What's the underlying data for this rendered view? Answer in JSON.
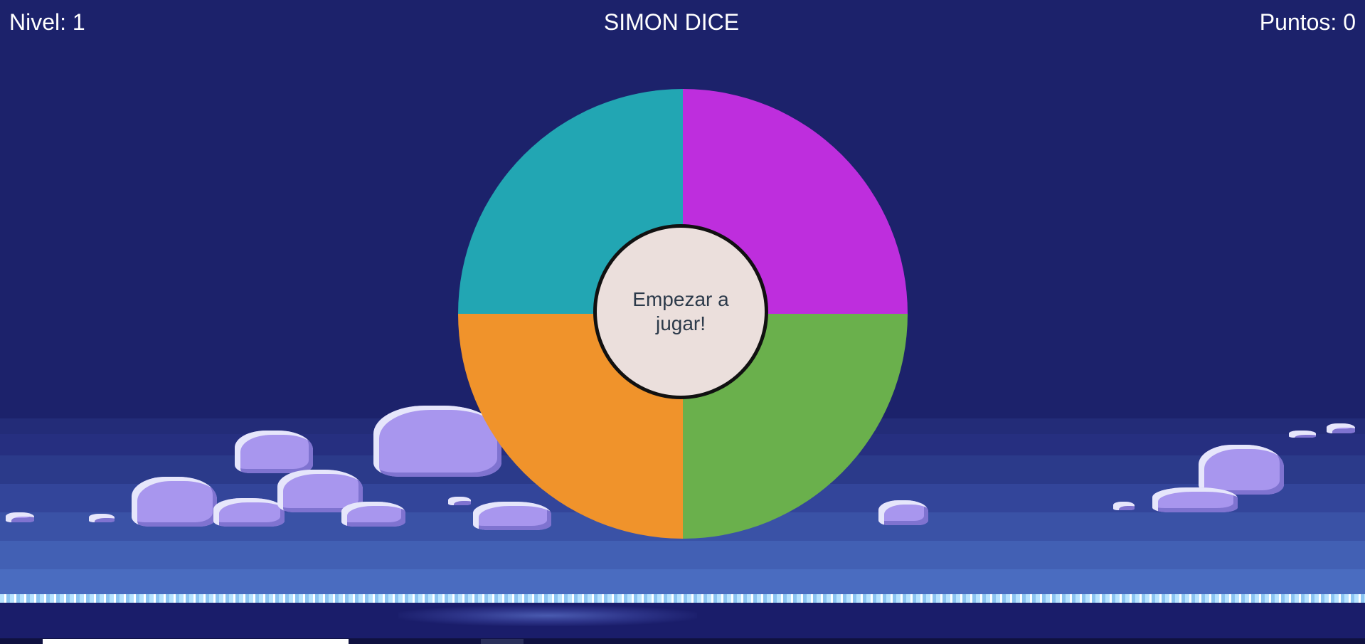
{
  "header": {
    "level_text": "Nivel: 1",
    "title": "SIMON DICE",
    "score_text": "Puntos: 0"
  },
  "board": {
    "colors": {
      "top_left": "#22a6b3",
      "top_right": "#be2edd",
      "bottom_left": "#f0932b",
      "bottom_right": "#6ab04c"
    },
    "start_label": "Empezar a jugar!"
  }
}
